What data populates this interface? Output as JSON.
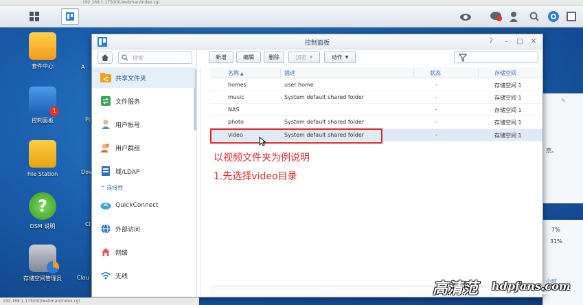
{
  "browser": {
    "url": "192.168.1.175000/webman/index.cgi",
    "status": "192.168.1.175000/webman/index.cgi"
  },
  "desktop": {
    "icons": [
      {
        "label": "套件中心"
      },
      {
        "label": "控制面板",
        "badge": "1"
      },
      {
        "label": "File Station"
      },
      {
        "label": "DSM 说明"
      },
      {
        "label": "存储空间管理员"
      }
    ],
    "partial_labels": [
      "A",
      "Pl",
      "Dov",
      "Cl",
      "Clou"
    ]
  },
  "window": {
    "title": "控制面板",
    "search_placeholder": "搜索",
    "sidebar": {
      "items": [
        {
          "label": "共享文件夹",
          "icon": "shared-folder-icon"
        },
        {
          "label": "文件服务",
          "icon": "file-services-icon"
        },
        {
          "label": "用户帐号",
          "icon": "user-icon"
        },
        {
          "label": "用户群组",
          "icon": "group-icon"
        },
        {
          "label": "域/LDAP",
          "icon": "domain-icon"
        },
        {
          "label": "QuickConnect",
          "icon": "quickconnect-icon"
        },
        {
          "label": "外部访问",
          "icon": "external-access-icon"
        },
        {
          "label": "网络",
          "icon": "network-icon"
        },
        {
          "label": "无线",
          "icon": "wireless-icon"
        }
      ],
      "section_connectivity": "连接性"
    },
    "toolbar": {
      "create": "新增",
      "edit": "编辑",
      "delete": "删除",
      "encrypt": "加密",
      "action": "动作",
      "filter_placeholder": ""
    },
    "grid": {
      "columns": {
        "name": "名称",
        "description": "描述",
        "status": "状态",
        "volume": "存储空间"
      },
      "rows": [
        {
          "name": "homes",
          "description": "user home",
          "status": "-",
          "volume": "存储空间 1"
        },
        {
          "name": "music",
          "description": "System default shared folder",
          "status": "-",
          "volume": "存储空间 1"
        },
        {
          "name": "NAS",
          "description": "",
          "status": "-",
          "volume": "存储空间 1"
        },
        {
          "name": "photo",
          "description": "System default shared folder",
          "status": "-",
          "volume": "存储空间 1"
        },
        {
          "name": "video",
          "description": "System default shared folder",
          "status": "-",
          "volume": "存储空间 1"
        }
      ]
    }
  },
  "annotations": {
    "line1": "以视频文件夹为例说明",
    "line2": "1.先选择video目录"
  },
  "right_widget": {
    "text1": "京。",
    "pct1": "7%",
    "pct2": "31%",
    "footer": "小时"
  },
  "watermark": {
    "cn": "高清范",
    "en": "hdpfans.com"
  },
  "colors": {
    "accent": "#3b6fa8",
    "annotation": "#e02b2b",
    "selected_row": "#dfeaf6"
  }
}
